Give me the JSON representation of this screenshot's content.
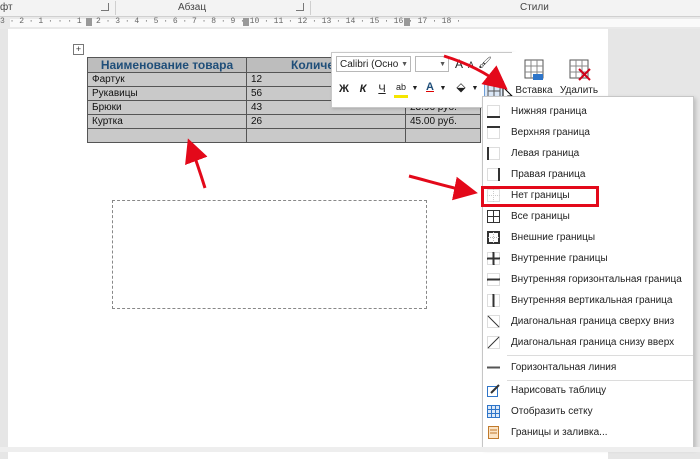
{
  "ribbon": {
    "group_font_label": "фт",
    "group_paragraph_label": "Абзац",
    "group_styles_label": "Стили"
  },
  "ruler": {
    "numbers": "3 · 2 · 1 · · · 1 · 2 · 3 · 4 · 5 · 6 · 7 · 8 · 9 · 10 · 11 · 12 · 13 · 14 · 15 · 16 · 17 · 18 ·"
  },
  "document_table": {
    "headers": [
      "Наименование товара",
      "Количество",
      ""
    ],
    "rows": [
      [
        "Фартук",
        "12",
        ""
      ],
      [
        "Рукавицы",
        "56",
        ""
      ],
      [
        "Брюки",
        "43",
        "23.96 руб."
      ],
      [
        "Куртка",
        "26",
        "45.00 руб."
      ],
      [
        "",
        "",
        ""
      ]
    ]
  },
  "mini_toolbar": {
    "font_name": "Calibri (Осно",
    "font_size": "",
    "grow_font": "A",
    "shrink_font": "A",
    "bold": "Ж",
    "italic": "К",
    "underline": "Ч",
    "font_color_letter": "A",
    "insert_label": "Вставка",
    "delete_label": "Удалить"
  },
  "borders_menu": {
    "items": [
      {
        "label": "Нижняя граница",
        "icon": "border-bottom-icon"
      },
      {
        "label": "Верхняя граница",
        "icon": "border-top-icon"
      },
      {
        "label": "Левая граница",
        "icon": "border-left-icon"
      },
      {
        "label": "Правая граница",
        "icon": "border-right-icon"
      },
      {
        "label": "Нет границы",
        "icon": "border-none-icon"
      },
      {
        "label": "Все границы",
        "icon": "border-all-icon"
      },
      {
        "label": "Внешние границы",
        "icon": "border-outside-icon"
      },
      {
        "label": "Внутренние границы",
        "icon": "border-inside-icon"
      },
      {
        "label": "Внутренняя горизонтальная граница",
        "icon": "border-inside-horizontal-icon"
      },
      {
        "label": "Внутренняя вертикальная граница",
        "icon": "border-inside-vertical-icon"
      },
      {
        "label": "Диагональная граница сверху вниз",
        "icon": "border-diagonal-down-icon"
      },
      {
        "label": "Диагональная граница снизу вверх",
        "icon": "border-diagonal-up-icon"
      },
      {
        "label": "Горизонтальная линия",
        "icon": "horizontal-line-icon"
      },
      {
        "label": "Нарисовать таблицу",
        "icon": "draw-table-icon"
      },
      {
        "label": "Отобразить сетку",
        "icon": "view-gridlines-icon"
      },
      {
        "label": "Границы и заливка...",
        "icon": "borders-shading-icon"
      }
    ]
  },
  "colors": {
    "highlight_box": "#e3091a",
    "annotation_arrow": "#e3091a",
    "table_header_text": "#1f4e79",
    "table_row_fill": "#c9c9c9"
  }
}
